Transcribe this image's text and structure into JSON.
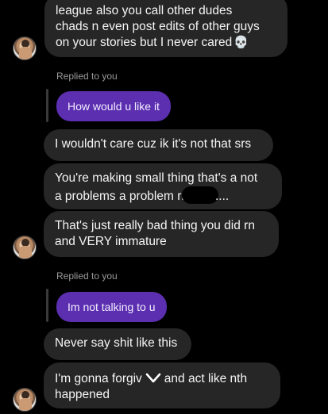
{
  "messages": {
    "m1": {
      "lines": [
        "league also you call other dudes",
        "chads n even post edits of other guys",
        "on your stories but I never cared"
      ],
      "emoji": "💀"
    },
    "reply1": {
      "label": "Replied to you",
      "quote": "How would u like it"
    },
    "m2": {
      "text": "I wouldn't care cuz ik it's not that srs"
    },
    "m3": {
      "line1": "You're making small thing that's a not",
      "line2_start": "a problems a problem rn",
      "line2_end": "...."
    },
    "m4": {
      "lines": [
        "That's just really bad thing you did rn",
        "and VERY immature"
      ]
    },
    "reply2": {
      "label": "Replied to you",
      "quote": "Im not talking to u"
    },
    "m5": {
      "text": "Never say shit like this"
    },
    "m6": {
      "line1_start": "I'm gonna forgiv",
      "line1_end": "and act like nth",
      "line2": "happened"
    }
  }
}
